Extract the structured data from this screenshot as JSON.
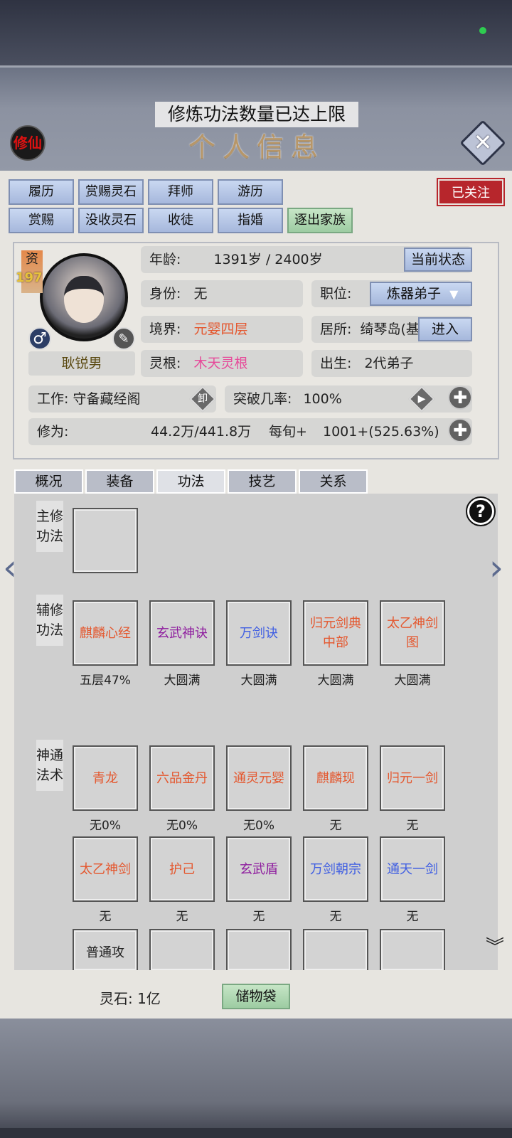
{
  "header": {
    "toast": "修炼功法数量已达上限",
    "title": "个人信息",
    "seal": "修仙",
    "close_icon": "✕",
    "follow": "已关注"
  },
  "action_buttons": [
    {
      "label": "履历",
      "style": "blue"
    },
    {
      "label": "赏赐灵石",
      "style": "blue"
    },
    {
      "label": "拜师",
      "style": "blue"
    },
    {
      "label": "游历",
      "style": "blue"
    },
    {
      "label": "赏赐",
      "style": "blue"
    },
    {
      "label": "没收灵石",
      "style": "blue"
    },
    {
      "label": "收徒",
      "style": "blue"
    },
    {
      "label": "指婚",
      "style": "blue"
    },
    {
      "label": "逐出家族",
      "style": "green"
    }
  ],
  "character": {
    "aptitude_label": "资",
    "aptitude_value": "197",
    "gender_icon": "♂",
    "edit_icon": "✎",
    "name": "耿锐男",
    "age_label": "年龄:",
    "age_value": "1391岁 / 2400岁",
    "status_button": "当前状态",
    "identity_label": "身份:",
    "identity_value": "无",
    "position_label": "职位:",
    "position_value": "炼器弟子",
    "position_arrow": "▼",
    "realm_label": "境界:",
    "realm_value": "元婴四层",
    "residence_label": "居所:",
    "residence_value": "绮琴岛(基",
    "enter_button": "进入",
    "root_label": "灵根:",
    "root_value": "木天灵根",
    "birth_label": "出生:",
    "birth_value": "2代弟子",
    "work_label": "工作:",
    "work_value": "守备藏经阁",
    "unload_icon": "卸",
    "breakthrough_label": "突破几率:",
    "breakthrough_value": "100%",
    "play_icon": "▶",
    "plus_icon": "✚",
    "cultivation_label": "修为:",
    "cultivation_value": "44.2万/441.8万",
    "per_turn_label": "每旬+",
    "per_turn_value": "1001+(525.63%)"
  },
  "tabs": [
    "概况",
    "装备",
    "功法",
    "技艺",
    "关系"
  ],
  "active_tab": "功法",
  "sections": {
    "main": "主修功法",
    "aux": "辅修功法",
    "magic": "神通法术"
  },
  "aux_skills": [
    {
      "name": "麒麟心经",
      "level": "五层47%",
      "color": "orange"
    },
    {
      "name": "玄武神诀",
      "level": "大圆满",
      "color": "purple"
    },
    {
      "name": "万剑诀",
      "level": "大圆满",
      "color": "blue"
    },
    {
      "name": "归元剑典中部",
      "level": "大圆满",
      "color": "orange"
    },
    {
      "name": "太乙神剑图",
      "level": "大圆满",
      "color": "orange"
    }
  ],
  "magic_skills": [
    {
      "name": "青龙",
      "level": "无0%",
      "color": "orange"
    },
    {
      "name": "六品金丹",
      "level": "无0%",
      "color": "orange"
    },
    {
      "name": "通灵元婴",
      "level": "无0%",
      "color": "orange"
    },
    {
      "name": "麒麟现",
      "level": "无",
      "color": "orange"
    },
    {
      "name": "归元一剑",
      "level": "无",
      "color": "orange"
    },
    {
      "name": "太乙神剑",
      "level": "无",
      "color": "orange"
    },
    {
      "name": "护己",
      "level": "无",
      "color": "orange"
    },
    {
      "name": "玄武盾",
      "level": "无",
      "color": "purple"
    },
    {
      "name": "万剑朝宗",
      "level": "无",
      "color": "blue"
    },
    {
      "name": "通天一剑",
      "level": "无",
      "color": "blue"
    },
    {
      "name": "普通攻",
      "level": "",
      "color": "dark"
    },
    {
      "name": "",
      "level": "",
      "color": "dark"
    },
    {
      "name": "",
      "level": "",
      "color": "dark"
    },
    {
      "name": "",
      "level": "",
      "color": "dark"
    },
    {
      "name": "",
      "level": "",
      "color": "dark"
    }
  ],
  "icons": {
    "help": "?",
    "nav_left": "‹",
    "nav_right": "›",
    "scroll_down": "︾"
  },
  "bottom": {
    "spirit_stone": "灵石: 1亿",
    "bag": "储物袋"
  },
  "colors": {
    "orange": "#e4572e",
    "purple": "#8e1c9e",
    "blue": "#3f5ee2",
    "pink": "#e64b9a",
    "follow_red": "#b7262c"
  }
}
